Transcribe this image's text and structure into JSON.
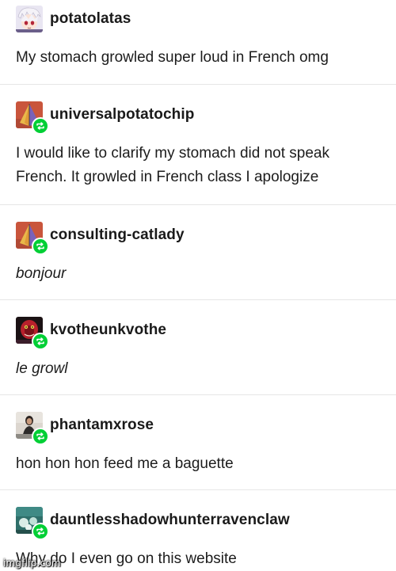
{
  "posts": [
    {
      "username": "potatolatas",
      "text_lines": [
        "My stomach growled super loud in French omg"
      ],
      "italic": false,
      "reblog": false,
      "avatar": "anime-character-avatar"
    },
    {
      "username": "universalpotatochip",
      "text_lines": [
        "I would like to clarify my stomach did not speak",
        "French. It growled in French class I apologize"
      ],
      "italic": false,
      "reblog": true,
      "avatar": "pyramid-art-avatar"
    },
    {
      "username": "consulting-catlady",
      "text_lines": [
        "bonjour"
      ],
      "italic": true,
      "reblog": true,
      "avatar": "pyramid-art-avatar"
    },
    {
      "username": "kvotheunkvothe",
      "text_lines": [
        "le growl"
      ],
      "italic": true,
      "reblog": true,
      "avatar": "red-character-avatar"
    },
    {
      "username": "phantamxrose",
      "text_lines": [
        "hon hon hon feed me a baguette"
      ],
      "italic": false,
      "reblog": true,
      "avatar": "person-photo-avatar"
    },
    {
      "username": "dauntlesshadowhunterravenclaw",
      "text_lines": [
        "Why do I even go on this website"
      ],
      "italic": false,
      "reblog": true,
      "avatar": "teal-scene-avatar"
    }
  ],
  "watermark": "imgflip.com",
  "colors": {
    "reblog_green": "#00cf35",
    "divider": "#e6e6e6",
    "text": "#1c1c1c"
  }
}
